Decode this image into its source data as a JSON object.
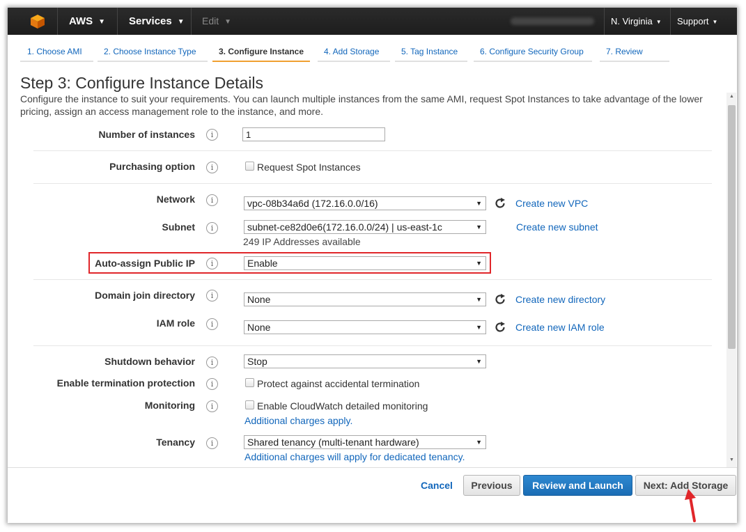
{
  "nav": {
    "aws": "AWS",
    "services": "Services",
    "edit": "Edit",
    "region": "N. Virginia",
    "support": "Support",
    "logo_icon": "aws-cube-icon",
    "caret_icon": "chevron-down-icon"
  },
  "tabs": [
    {
      "label": "1. Choose AMI"
    },
    {
      "label": "2. Choose Instance Type"
    },
    {
      "label": "3. Configure Instance"
    },
    {
      "label": "4. Add Storage"
    },
    {
      "label": "5. Tag Instance"
    },
    {
      "label": "6. Configure Security Group"
    },
    {
      "label": "7. Review"
    }
  ],
  "page": {
    "title": "Step 3: Configure Instance Details",
    "description": "Configure the instance to suit your requirements. You can launch multiple instances from the same AMI, request Spot Instances to take advantage of the lower pricing, assign an access management role to the instance, and more."
  },
  "form": {
    "instances": {
      "label": "Number of instances",
      "value": "1"
    },
    "purchasing": {
      "label": "Purchasing option",
      "checkbox_label": "Request Spot Instances"
    },
    "network": {
      "label": "Network",
      "value": "vpc-08b34a6d (172.16.0.0/16)",
      "link": "Create new VPC"
    },
    "subnet": {
      "label": "Subnet",
      "value": "subnet-ce82d0e6(172.16.0.0/24) | us-east-1c",
      "link": "Create new subnet",
      "note": "249 IP Addresses available"
    },
    "public_ip": {
      "label": "Auto-assign Public IP",
      "value": "Enable"
    },
    "domain": {
      "label": "Domain join directory",
      "value": "None",
      "link": "Create new directory"
    },
    "iam": {
      "label": "IAM role",
      "value": "None",
      "link": "Create new IAM role"
    },
    "shutdown": {
      "label": "Shutdown behavior",
      "value": "Stop"
    },
    "termination": {
      "label": "Enable termination protection",
      "checkbox_label": "Protect against accidental termination"
    },
    "monitoring": {
      "label": "Monitoring",
      "checkbox_label": "Enable CloudWatch detailed monitoring",
      "note": "Additional charges apply."
    },
    "tenancy": {
      "label": "Tenancy",
      "value": "Shared tenancy (multi-tenant hardware)",
      "note": "Additional charges will apply for dedicated tenancy."
    }
  },
  "info_glyph": "i",
  "footer": {
    "cancel": "Cancel",
    "previous": "Previous",
    "review": "Review and Launch",
    "next": "Next: Add Storage"
  },
  "colors": {
    "link": "#1166bb",
    "primary_button": "#1a6db5",
    "highlight": "#e0262a",
    "active_tab": "#f0a030"
  }
}
